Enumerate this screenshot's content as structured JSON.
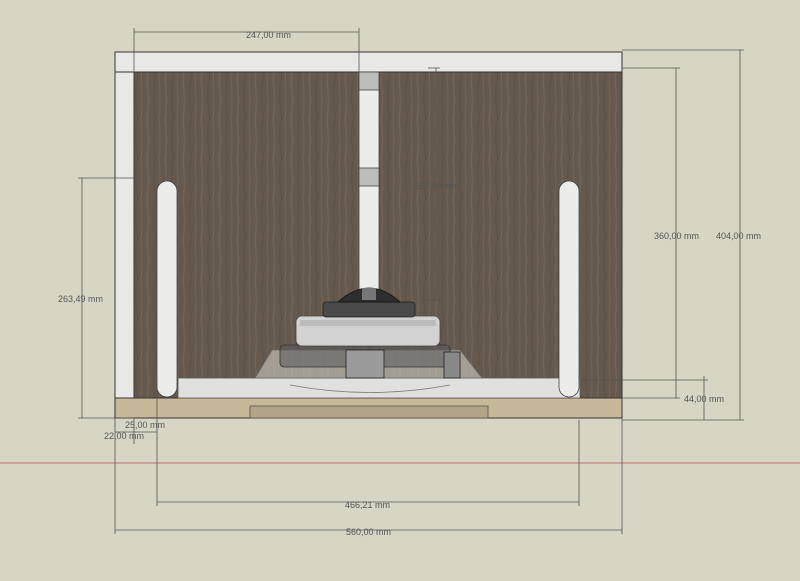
{
  "dimensions": {
    "top_width": "247,00 mm",
    "inner_height": "250,00 mm",
    "left_height": "263,49 mm",
    "right_inner_height": "360,00 mm",
    "right_total_height": "404,00 mm",
    "bottom_offset": "44,00 mm",
    "small_a": "25,00 mm",
    "small_b": "22,00 mm",
    "slot_span": "466,21 mm",
    "total_width": "560,00 mm"
  },
  "colors": {
    "background": "#d7d6c4",
    "wood_dark": "#64594c",
    "panel_white": "#e8e8e6",
    "base_wood": "#c8b89a",
    "ground_line": "#c76a6a",
    "dimension_line": "#555555"
  }
}
